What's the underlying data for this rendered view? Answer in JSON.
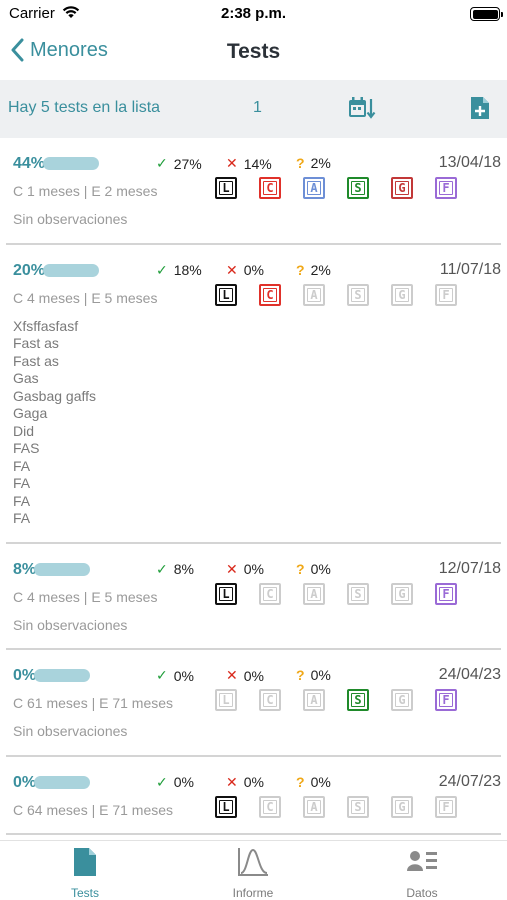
{
  "status_bar": {
    "carrier": "Carrier",
    "time": "2:38 p.m."
  },
  "nav": {
    "back_label": "Menores",
    "title": "Tests"
  },
  "sub_header": {
    "count_text": "Hay 5 tests en la lista",
    "page": "1"
  },
  "colors": {
    "accent": "#3a8f9d",
    "progress_track": "#a9d3dc",
    "check": "#1f9d3a",
    "cross": "#d9291c",
    "question": "#f0a818",
    "letter_L": "#111111",
    "letter_C": "#e0312a",
    "letter_A": "#6d8fd6",
    "letter_S": "#1f8a2a",
    "letter_G": "#c23838",
    "letter_F": "#9a6ad6",
    "letter_inactive": "#cccccc"
  },
  "tests": [
    {
      "pct": "44%",
      "progress": 0.44,
      "ok": "27%",
      "ko": "14%",
      "unknown": "2%",
      "date": "13/04/18",
      "ages": "C 1 meses | E 2 meses",
      "letters": [
        {
          "char": "L",
          "active": true
        },
        {
          "char": "C",
          "active": true
        },
        {
          "char": "A",
          "active": true
        },
        {
          "char": "S",
          "active": true
        },
        {
          "char": "G",
          "active": true
        },
        {
          "char": "F",
          "active": true
        }
      ],
      "notes": [
        "Sin observaciones"
      ]
    },
    {
      "pct": "20%",
      "progress": 0.2,
      "ok": "18%",
      "ko": "0%",
      "unknown": "2%",
      "date": "11/07/18",
      "ages": "C 4 meses | E 5 meses",
      "letters": [
        {
          "char": "L",
          "active": true
        },
        {
          "char": "C",
          "active": true
        },
        {
          "char": "A",
          "active": false
        },
        {
          "char": "S",
          "active": false
        },
        {
          "char": "G",
          "active": false
        },
        {
          "char": "F",
          "active": false
        }
      ],
      "notes": [
        "Xfsffasfasf",
        "Fast as",
        "Fast as",
        "Gas",
        "Gasbag gaffs",
        "Gaga",
        "Did",
        "FAS",
        "FA",
        "FA",
        "FA",
        "FA"
      ]
    },
    {
      "pct": "8%",
      "progress": 0.08,
      "ok": "8%",
      "ko": "0%",
      "unknown": "0%",
      "date": "12/07/18",
      "ages": "C 4 meses | E 5 meses",
      "letters": [
        {
          "char": "L",
          "active": true
        },
        {
          "char": "C",
          "active": false
        },
        {
          "char": "A",
          "active": false
        },
        {
          "char": "S",
          "active": false
        },
        {
          "char": "G",
          "active": false
        },
        {
          "char": "F",
          "active": true
        }
      ],
      "notes": [
        "Sin observaciones"
      ]
    },
    {
      "pct": "0%",
      "progress": 0.0,
      "ok": "0%",
      "ko": "0%",
      "unknown": "0%",
      "date": "24/04/23",
      "ages": "C 61 meses | E 71 meses",
      "letters": [
        {
          "char": "L",
          "active": false
        },
        {
          "char": "C",
          "active": false
        },
        {
          "char": "A",
          "active": false
        },
        {
          "char": "S",
          "active": true
        },
        {
          "char": "G",
          "active": false
        },
        {
          "char": "F",
          "active": true
        }
      ],
      "notes": [
        "Sin observaciones"
      ]
    },
    {
      "pct": "0%",
      "progress": 0.0,
      "ok": "0%",
      "ko": "0%",
      "unknown": "0%",
      "date": "24/07/23",
      "ages": "C 64 meses | E 71 meses",
      "letters": [
        {
          "char": "L",
          "active": true
        },
        {
          "char": "C",
          "active": false
        },
        {
          "char": "A",
          "active": false
        },
        {
          "char": "S",
          "active": false
        },
        {
          "char": "G",
          "active": false
        },
        {
          "char": "F",
          "active": false
        }
      ],
      "notes": []
    }
  ],
  "tabs": [
    {
      "label": "Tests",
      "icon": "document-icon",
      "active": true
    },
    {
      "label": "Informe",
      "icon": "bell-curve-chart-icon",
      "active": false
    },
    {
      "label": "Datos",
      "icon": "contact-card-icon",
      "active": false
    }
  ]
}
